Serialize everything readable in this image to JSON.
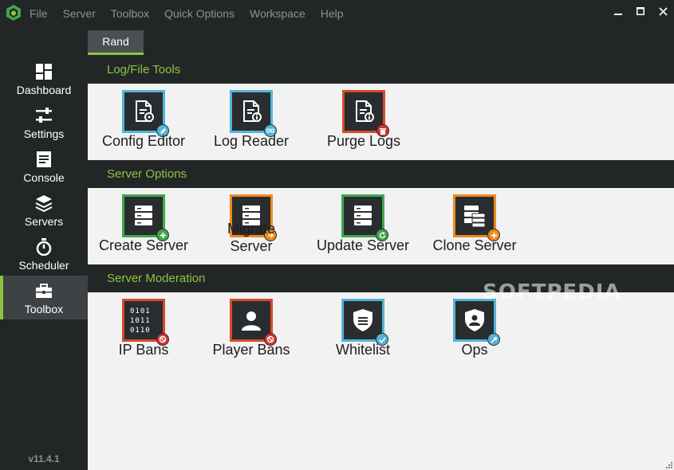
{
  "menu": {
    "items": [
      "File",
      "Server",
      "Toolbox",
      "Quick Options",
      "Workspace",
      "Help"
    ]
  },
  "sidebar": {
    "items": [
      {
        "label": "Dashboard",
        "icon": "dashboard-icon"
      },
      {
        "label": "Settings",
        "icon": "sliders-icon"
      },
      {
        "label": "Console",
        "icon": "console-icon"
      },
      {
        "label": "Servers",
        "icon": "layers-icon"
      },
      {
        "label": "Scheduler",
        "icon": "stopwatch-icon"
      },
      {
        "label": "Toolbox",
        "icon": "toolbox-icon",
        "active": true
      }
    ],
    "version": "v11.4.1"
  },
  "tab": {
    "label": "Rand"
  },
  "sections": [
    {
      "title": "Log/File Tools",
      "tiles": [
        {
          "label": "Config Editor",
          "border": "#52b4d8",
          "badge": "pencil-icon"
        },
        {
          "label": "Log Reader",
          "border": "#52b4d8",
          "badge": "glasses-icon"
        },
        {
          "label": "Purge Logs",
          "border": "#d9482b",
          "badge": "trash-icon"
        }
      ]
    },
    {
      "title": "Server Options",
      "tiles": [
        {
          "label": "Create Server",
          "border": "#3ea84a",
          "badge": "plus-icon"
        },
        {
          "label_line1": "Migrate",
          "label_line2": "Server",
          "border": "#ee8a1e",
          "badge": "arrow-icon"
        },
        {
          "label": "Update Server",
          "border": "#3ea84a",
          "badge": "refresh-icon"
        },
        {
          "label": "Clone Server",
          "border": "#ee8a1e",
          "badge": "plus-icon"
        }
      ]
    },
    {
      "title": "Server Moderation",
      "tiles": [
        {
          "label": "IP Bans",
          "border": "#d9482b",
          "badge": "ban-icon",
          "binary": [
            "0101",
            "1011",
            "0110"
          ]
        },
        {
          "label": "Player Bans",
          "border": "#d9482b",
          "badge": "ban-icon"
        },
        {
          "label": "Whitelist",
          "border": "#52b4d8",
          "badge": "check-icon"
        },
        {
          "label": "Ops",
          "border": "#52b4d8",
          "badge": "wrench-icon"
        }
      ]
    }
  ],
  "watermark": "SOFTPEDIA",
  "colors": {
    "accent": "#8cc63f",
    "sidebar": "#232627",
    "content": "#f2f2f2"
  }
}
